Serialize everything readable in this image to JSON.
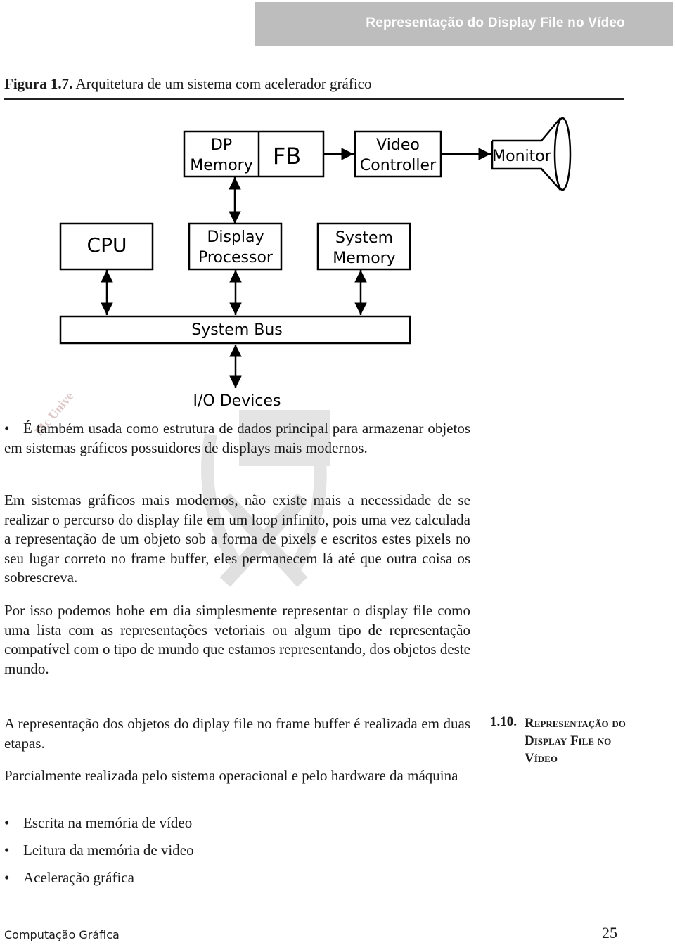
{
  "header": {
    "title": "Representação do Display File no Vídeo",
    "bar_color": "#bdbdbd"
  },
  "caption": {
    "label": "Figura  1.7.",
    "text": " Arquitetura de um sistema com acelerador gráfico"
  },
  "diagram": {
    "blocks": {
      "dp_memory": [
        "DP",
        "Memory"
      ],
      "fb": "FB",
      "video_controller": [
        "Video",
        "Controller"
      ],
      "monitor": "Monitor",
      "cpu": "CPU",
      "display_processor": [
        "Display",
        "Processor"
      ],
      "system_memory": [
        "System",
        "Memory"
      ],
      "system_bus": "System Bus",
      "io_devices": "I/O Devices"
    }
  },
  "watermark": {
    "text": "Mc Unive"
  },
  "body": {
    "bullet1": "É também usada como estrutura de dados principal para armazenar objetos em sistemas gráficos possuidores de displays mais modernos.",
    "para1": "Em sistemas gráficos mais modernos, não existe mais a necessidade de se realizar o percurso do display file em um loop infinito, pois uma vez calculada a representação de um objeto sob a forma de pixels e escritos estes pixels no seu lugar correto no frame buffer, eles permanecem lá até que outra coisa os sobrescreva.",
    "para2": "Por isso podemos hohe em dia simplesmente representar o display file como uma lista com as representações vetoriais ou algum tipo de representação compatível com o tipo de mundo que estamos representando, dos objetos deste mundo.",
    "para3": "A representação dos objetos do diplay file no frame buffer é realizada em duas etapas.",
    "para4": "Parcialmente realizada pelo sistema operacional e pelo hardware da máquina",
    "bullets": [
      "Escrita na memória de vídeo",
      "Leitura da memória de video",
      "Aceleração gráfica"
    ],
    "bullet_glyph": "•"
  },
  "section": {
    "number": "1.10.",
    "title": "Representação do Display File no Vídeo"
  },
  "footer": {
    "book": "Computação Gráfica",
    "page": "25"
  }
}
